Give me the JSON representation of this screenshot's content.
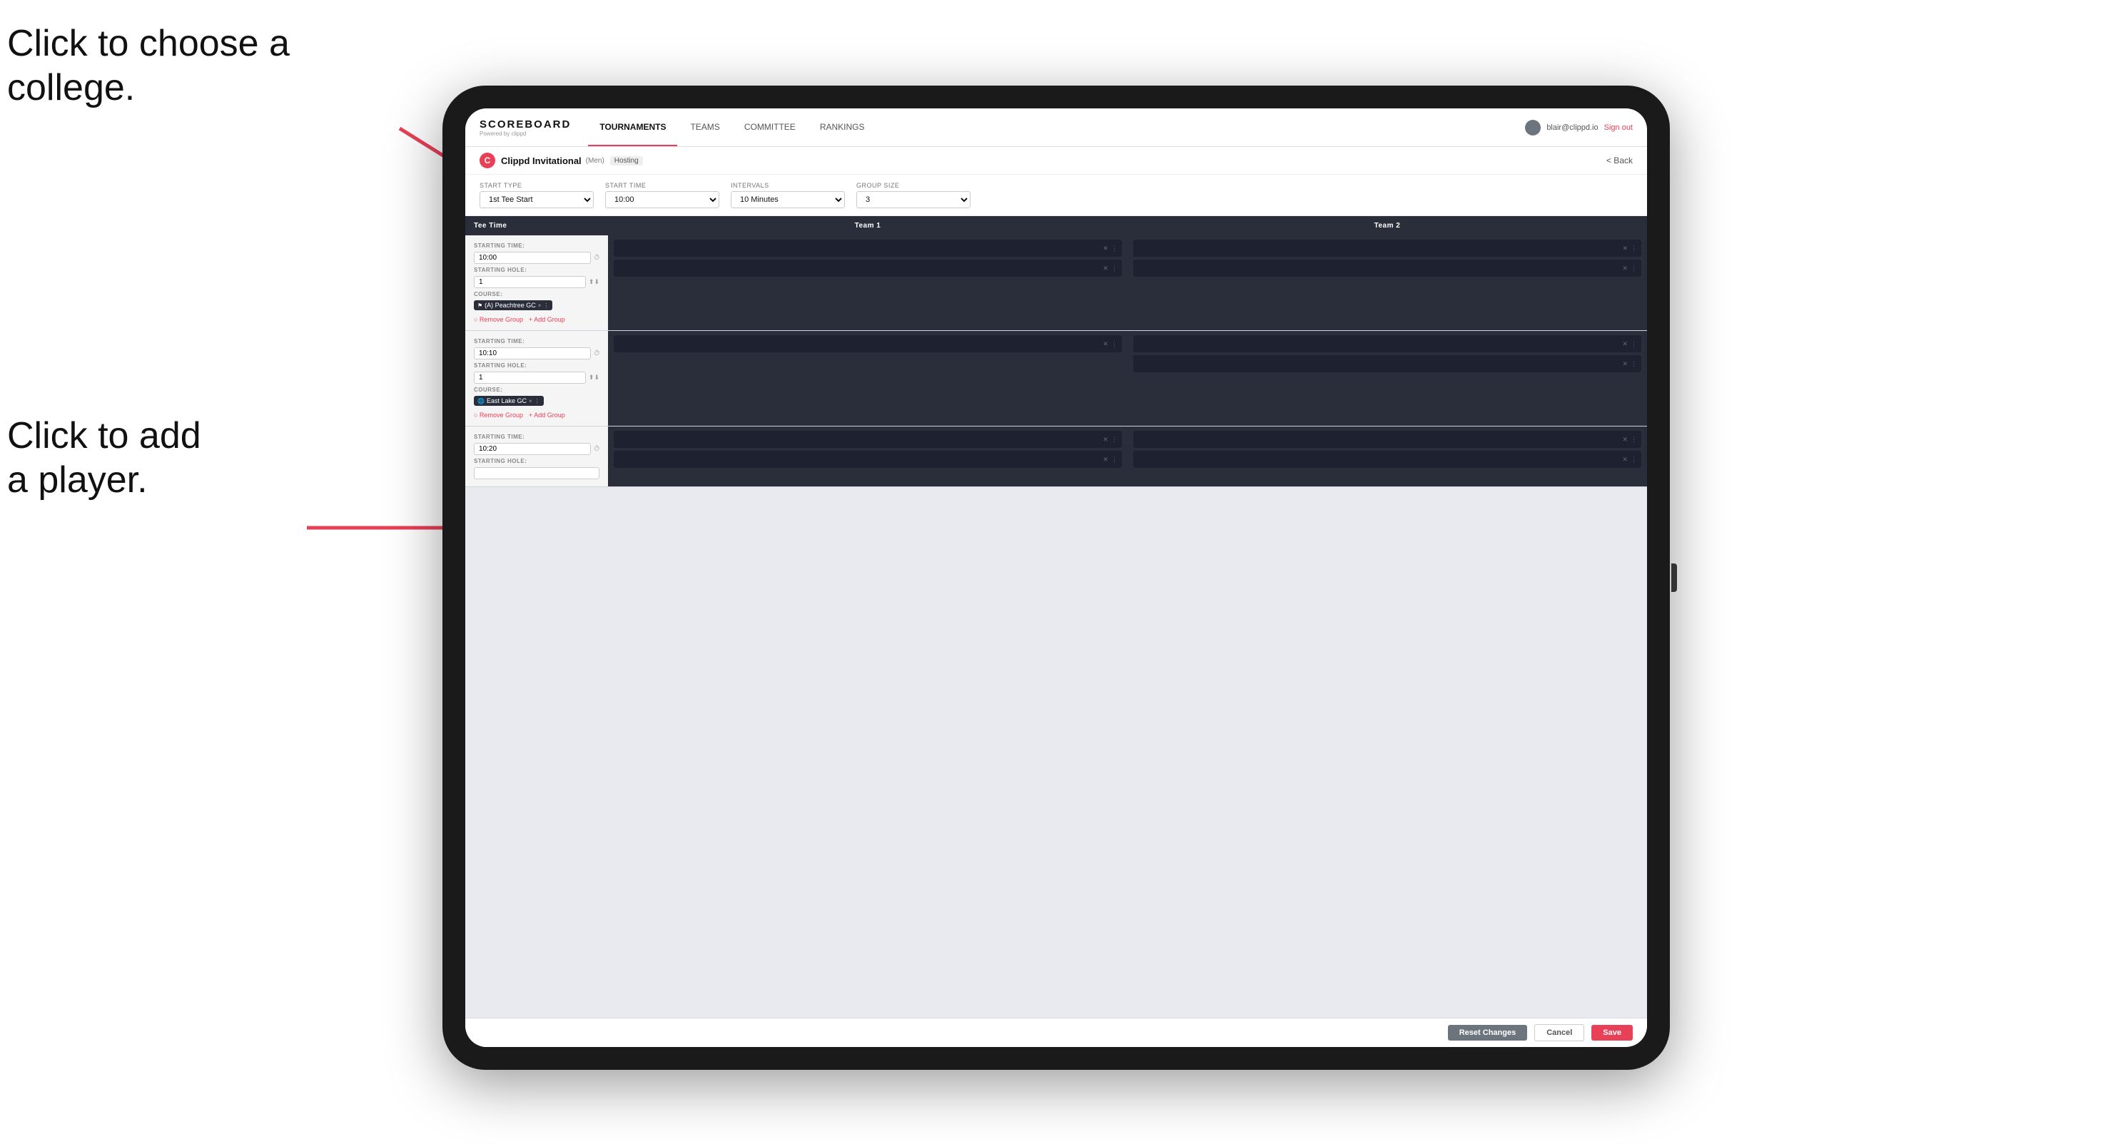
{
  "annotations": {
    "annotation1_line1": "Click to choose a",
    "annotation1_line2": "college.",
    "annotation2_line1": "Click to add",
    "annotation2_line2": "a player."
  },
  "nav": {
    "logo": "SCOREBOARD",
    "powered_by": "Powered by clippd",
    "tabs": [
      "TOURNAMENTS",
      "TEAMS",
      "COMMITTEE",
      "RANKINGS"
    ],
    "active_tab": "TOURNAMENTS",
    "user_email": "blair@clippd.io",
    "sign_out": "Sign out"
  },
  "sub_header": {
    "logo_letter": "C",
    "title": "Clippd Invitational",
    "badge": "(Men)",
    "hosting": "Hosting",
    "back": "< Back"
  },
  "form": {
    "start_type_label": "Start Type",
    "start_type_value": "1st Tee Start",
    "start_time_label": "Start Time",
    "start_time_value": "10:00",
    "intervals_label": "Intervals",
    "intervals_value": "10 Minutes",
    "group_size_label": "Group Size",
    "group_size_value": "3"
  },
  "table_header": {
    "col1": "Tee Time",
    "col2": "Team 1",
    "col3": "Team 2"
  },
  "groups": [
    {
      "starting_time": "10:00",
      "starting_hole": "1",
      "course": "(A) Peachtree GC",
      "team1_players": 2,
      "team2_players": 2,
      "show_course": true,
      "remove_group": "Remove Group",
      "add_group": "+ Add Group"
    },
    {
      "starting_time": "10:10",
      "starting_hole": "1",
      "course": "East Lake GC",
      "team1_players": 1,
      "team2_players": 2,
      "show_course": true,
      "remove_group": "Remove Group",
      "add_group": "+ Add Group"
    },
    {
      "starting_time": "10:20",
      "starting_hole": "",
      "course": "",
      "team1_players": 2,
      "team2_players": 2,
      "show_course": false,
      "remove_group": "",
      "add_group": ""
    }
  ],
  "buttons": {
    "reset": "Reset Changes",
    "cancel": "Cancel",
    "save": "Save"
  }
}
